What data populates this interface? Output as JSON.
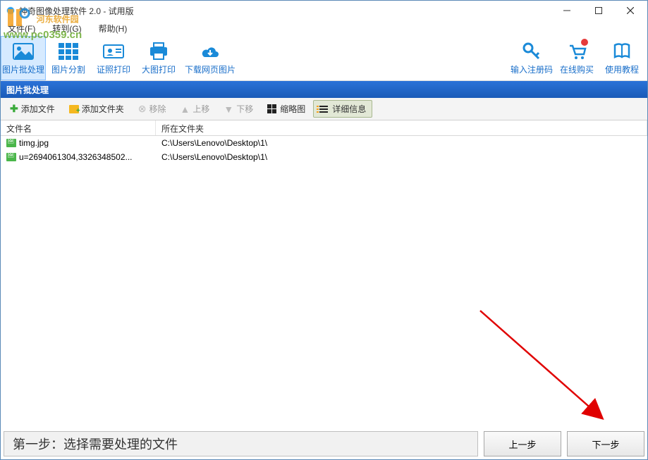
{
  "window": {
    "title": "神奇图像处理软件 2.0 - 试用版"
  },
  "menu": {
    "file": "文件(F)",
    "goto": "转到(G)",
    "help": "帮助(H)"
  },
  "watermark": {
    "line1": "河东软件园",
    "line2": "www.pc0359.cn"
  },
  "ribbon": {
    "batch": "图片批处理",
    "split": "图片分割",
    "idprint": "证照打印",
    "bigprint": "大图打印",
    "download": "下载网页图片",
    "regcode": "输入注册码",
    "buy": "在线购买",
    "tutorial": "使用教程"
  },
  "section": {
    "title": "图片批处理"
  },
  "toolbar": {
    "addfile": "添加文件",
    "addfolder": "添加文件夹",
    "remove": "移除",
    "moveup": "上移",
    "movedown": "下移",
    "thumb": "缩略图",
    "detail": "详细信息"
  },
  "columns": {
    "name": "文件名",
    "folder": "所在文件夹"
  },
  "rows": [
    {
      "name": "timg.jpg",
      "folder": "C:\\Users\\Lenovo\\Desktop\\1\\"
    },
    {
      "name": "u=2694061304,3326348502...",
      "folder": "C:\\Users\\Lenovo\\Desktop\\1\\"
    }
  ],
  "footer": {
    "step": "第一步：选择需要处理的文件",
    "prev": "上一步",
    "next": "下一步"
  }
}
